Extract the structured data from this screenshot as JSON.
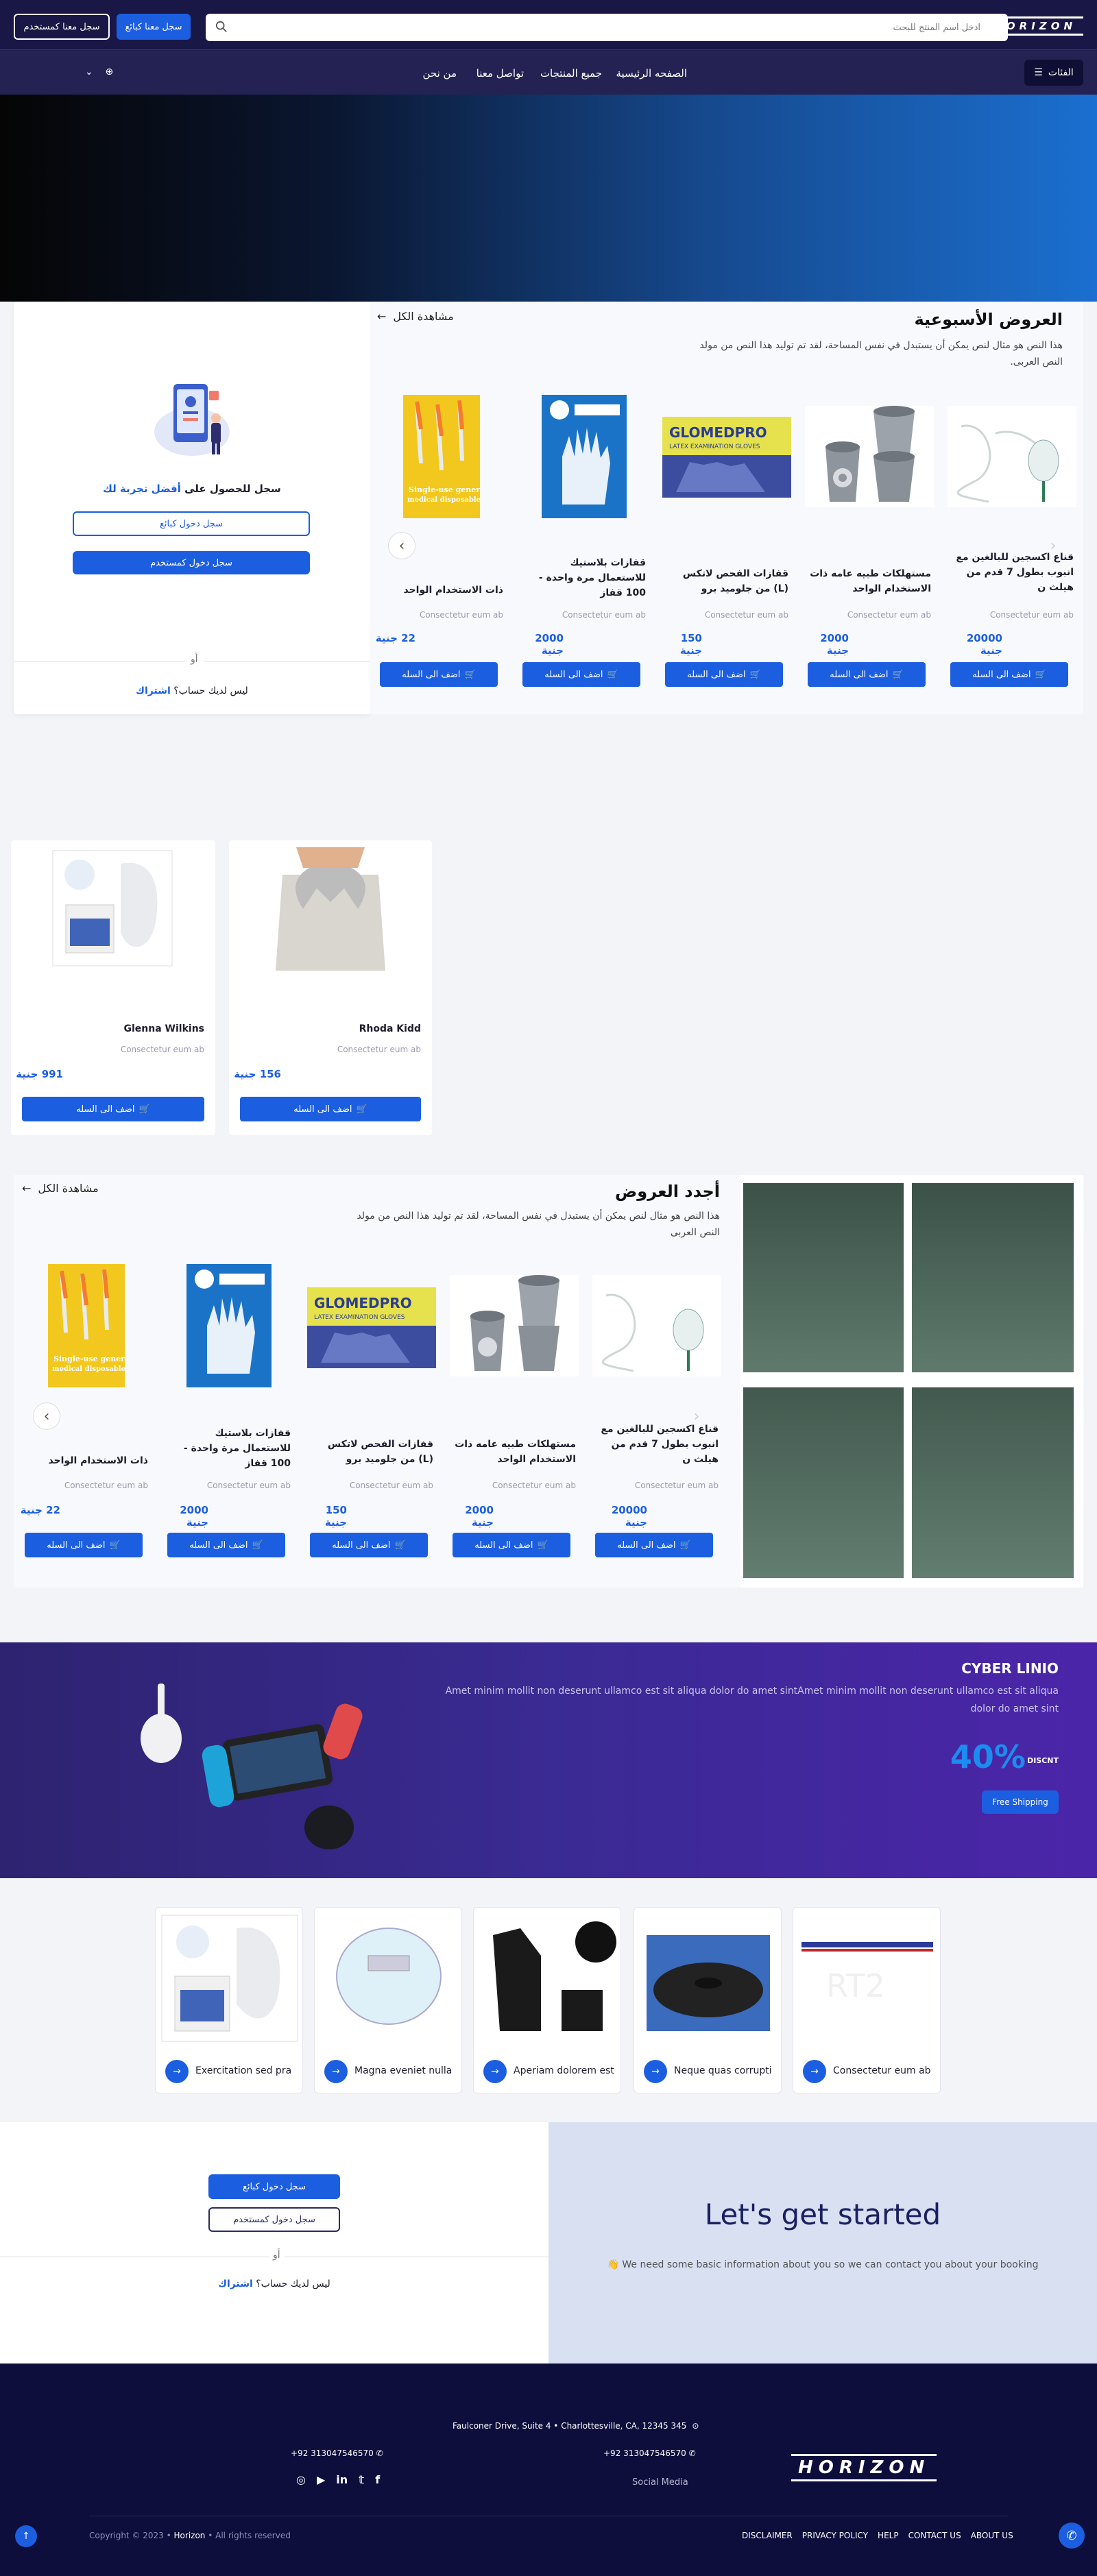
{
  "header": {
    "logo": "HORIZON",
    "search_placeholder": "ادخل اسم المنتج للبحث",
    "register_seller": "سجل معنا كبائع",
    "register_user": "سجل معنا كمستخدم",
    "categories": "الفئات",
    "nav": [
      "الصفحه الرئيسية",
      "جميع المنتجات",
      "تواصل معنا",
      "من نحن"
    ]
  },
  "weekly": {
    "title": "العروض الأسبوعية",
    "desc": "هذا النص هو مثال لنص يمكن أن يستبدل في نفس المساحة، لقد تم توليد هذا النص من مولد النص العربى.",
    "view_all": "مشاهدة الكل",
    "products": [
      {
        "name": "قناع اكسجين للبالغين مع انبوب بطول 7 قدم من هيلث ن",
        "sub": "Consectetur eum ab",
        "price": "20000 جنية",
        "btn": "اضف الى السله"
      },
      {
        "name": "مستهلكات طبيه عامه ذات الاستخدام الواحد",
        "sub": "Consectetur eum ab",
        "price": "2000 جنية",
        "btn": "اضف الى السله"
      },
      {
        "name": "قفازات الفحص لاتكس (L) من جلوميد برو",
        "sub": "Consectetur eum ab",
        "price": "150 جنية",
        "btn": "اضف الى السله"
      },
      {
        "name": "قفازات بلاستيك للاستعمال مرة واحدة - 100 قفاز",
        "sub": "Consectetur eum ab",
        "price": "2000 جنية",
        "btn": "اضف الى السله"
      },
      {
        "name": "ذات الاستخدام الواحد",
        "sub": "Consectetur eum ab",
        "price": "22 جنية",
        "btn": "اضف الى السله"
      }
    ]
  },
  "login_panel": {
    "title_prefix": "سجل للحصول على",
    "title_highlight": "أفضل تجربة لك",
    "seller_btn": "سجل دخول كبائع",
    "user_btn": "سجل دخول كمستخدم",
    "or": "أو",
    "no_account": "ليس لديك حساب؟",
    "join": "اشتراك"
  },
  "singles": [
    {
      "name": "Rhoda Kidd",
      "sub": "Consectetur eum ab",
      "price": "156 جنية",
      "btn": "اضف الى السله"
    },
    {
      "name": "Glenna Wilkins",
      "sub": "Consectetur eum ab",
      "price": "991 جنية",
      "btn": "اضف الى السله"
    }
  ],
  "newest": {
    "title": "أجدد العروض",
    "desc": "هذا النص هو مثال لنص يمكن أن يستبدل في نفس المساحة، لقد تم توليد هذا النص من مولد النص العربى",
    "view_all": "مشاهدة الكل",
    "products": [
      {
        "name": "قناع اكسجين للبالغين مع انبوب بطول 7 قدم من هيلث ن",
        "sub": "Consectetur eum ab",
        "price": "20000 جنية",
        "btn": "اضف الى السله"
      },
      {
        "name": "مستهلكات طبيه عامه ذات الاستخدام الواحد",
        "sub": "Consectetur eum ab",
        "price": "2000 جنية",
        "btn": "اضف الى السله"
      },
      {
        "name": "قفازات الفحص لاتكس (L) من جلوميد برو",
        "sub": "Consectetur eum ab",
        "price": "150 جنية",
        "btn": "اضف الى السله"
      },
      {
        "name": "قفازات بلاستيك للاستعمال مرة واحدة - 100 قفاز",
        "sub": "Consectetur eum ab",
        "price": "2000 جنية",
        "btn": "اضف الى السله"
      },
      {
        "name": "ذات الاستخدام الواحد",
        "sub": "Consectetur eum ab",
        "price": "22 جنية",
        "btn": "اضف الى السله"
      }
    ]
  },
  "promo": {
    "title": "CYBER LINIO",
    "desc": "Amet minim mollit non deserunt ullamco est sit aliqua dolor do amet sintAmet minim mollit non deserunt ullamco est sit aliqua dolor do amet sint",
    "percent": "40%",
    "discount": "DISCNT",
    "btn": "Free Shipping"
  },
  "categories": [
    "Consectetur eum ab",
    "Neque quas corrupti",
    "Aperiam dolorem est",
    "Magna eveniet nulla",
    "Exercitation sed pra"
  ],
  "started": {
    "seller_btn": "سجل دخول كبائع",
    "user_btn": "سجل دخول كمستخدم",
    "or": "أو",
    "no_account": "ليس لديك حساب؟",
    "join": "اشتراك",
    "title": "Let's get started",
    "sub": "👋 We need some basic information about you so we can contact you about your booking"
  },
  "footer": {
    "logo": "HORIZON",
    "address": "Faulconer Drive, Suite 4 • Charlottesville, CA, 12345 345",
    "phone1": "+92 313047546570",
    "phone2": "+92 313047546570",
    "social_label": "Social Media",
    "copyright_prefix": "Copyright © 2023 •",
    "brand": "Horizon",
    "rights": "• All rights reserved",
    "links": [
      "ABOUT US",
      "CONTACT US",
      "HELP",
      "PRIVACY POLICY",
      "DISCLAIMER"
    ]
  },
  "colors": {
    "primary": "#1c5ee0",
    "dark": "#181745",
    "promo": "#3a2a93"
  }
}
